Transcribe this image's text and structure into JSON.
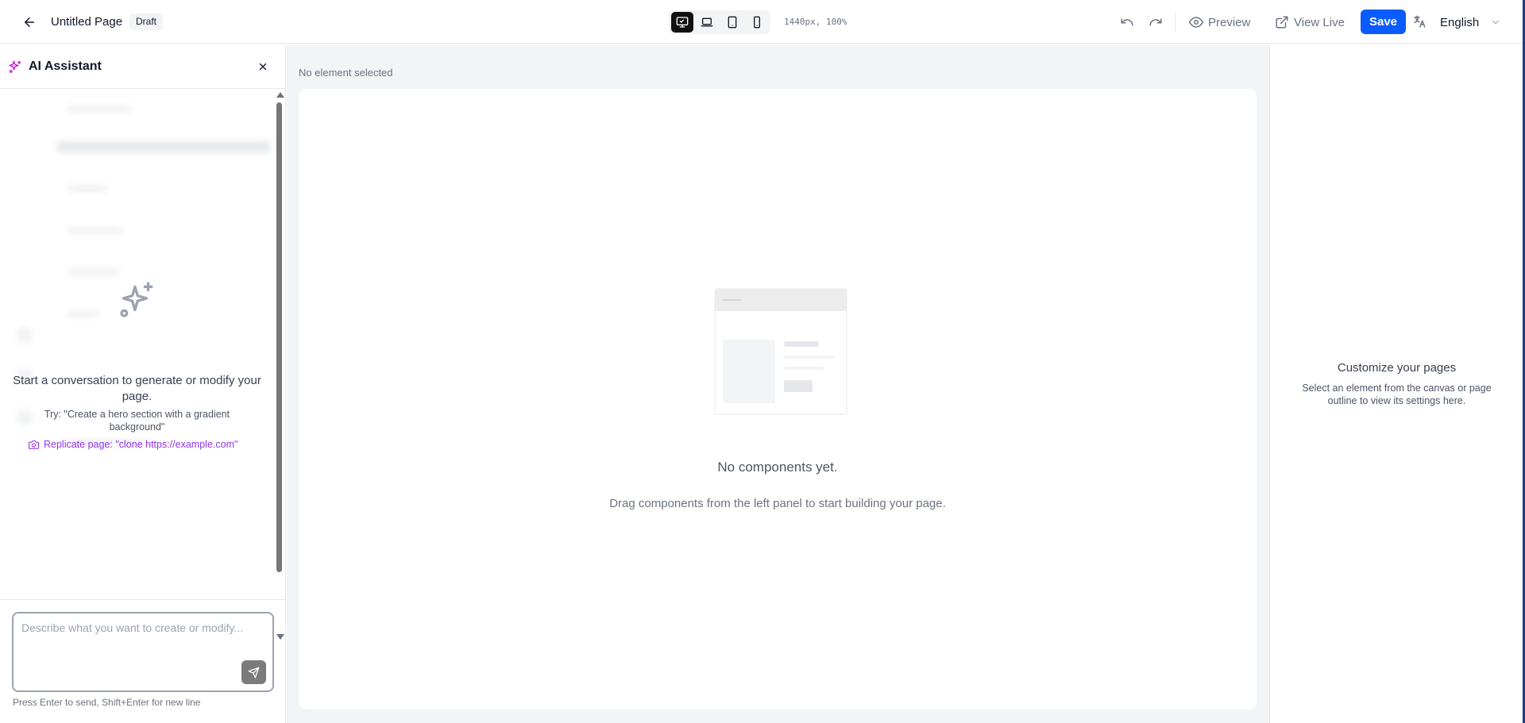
{
  "topbar": {
    "page_title": "Untitled Page",
    "status_badge": "Draft",
    "viewport_readout": "1440px, 100%",
    "preview_label": "Preview",
    "view_live_label": "View Live",
    "save_label": "Save",
    "language": "English",
    "device_modes": [
      "desktop",
      "laptop",
      "tablet",
      "mobile"
    ],
    "active_device": "desktop"
  },
  "ai_panel": {
    "title": "AI Assistant",
    "empty_title": "Start a conversation to generate or modify your page.",
    "empty_try": "Try: \"Create a hero section with a gradient background\"",
    "replicate_link": "Replicate page: \"clone https://example.com\"",
    "input_placeholder": "Describe what you want to create or modify...",
    "input_value": "",
    "input_hint": "Press Enter to send, Shift+Enter for new line"
  },
  "canvas": {
    "selection_label": "No element selected",
    "empty_title": "No components yet.",
    "empty_hint": "Drag components from the left panel to start building your page."
  },
  "settings_panel": {
    "title": "Customize your pages",
    "description": "Select an element from the canvas or page outline to view its settings here."
  },
  "colors": {
    "accent": "#0b5cff",
    "ai_accent": "#9333ea",
    "canvas_bg": "#f3f4f6"
  }
}
